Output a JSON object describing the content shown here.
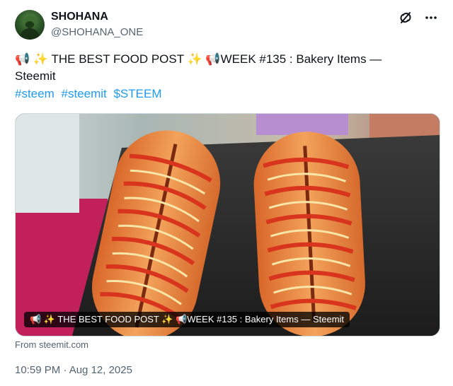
{
  "author": {
    "name": "SHOHANA",
    "handle": "@SHOHANA_ONE"
  },
  "icons": [
    "no-link-icon",
    "more-options-icon"
  ],
  "tweet": {
    "line1": "📢 ✨ THE BEST FOOD POST ✨ 📢WEEK #135 : Bakery Items —",
    "line2": "Steemit",
    "hashtags": [
      "#steem",
      "#steemit",
      "$STEEM"
    ]
  },
  "media": {
    "caption": "📢 ✨ THE BEST FOOD POST ✨ 📢WEEK #135 : Bakery Items — Steemit"
  },
  "source": "From steemit.com",
  "timestamp": "10:59 PM · Aug 12, 2025",
  "colors": {
    "link": "#1d9bf0",
    "secondary_text": "#536471",
    "sauce": "#d8341e",
    "bun": "#e8823c"
  }
}
